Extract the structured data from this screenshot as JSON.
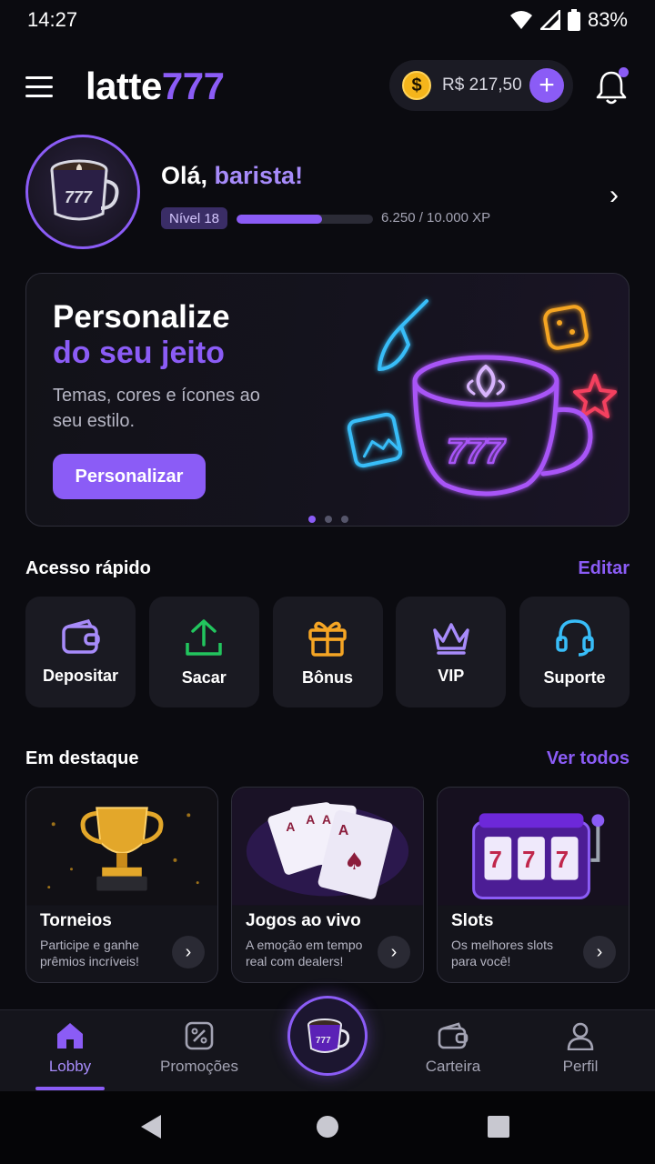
{
  "status": {
    "time": "14:27",
    "battery": "83%"
  },
  "header": {
    "logo_main": "latte",
    "logo_accent": "777",
    "balance": "R$ 217,50",
    "coin_symbol": "$",
    "add_symbol": "+"
  },
  "profile": {
    "greeting": "Olá, ",
    "name": "barista!",
    "level": "Nível 18",
    "xp_text": "6.250 / 10.000 XP",
    "xp_fraction": 0.625,
    "chevron": "›"
  },
  "banner": {
    "title_line1": "Personalize",
    "title_line2": "do seu jeito",
    "description": "Temas, cores e ícones ao seu estilo.",
    "button_label": "Personalizar",
    "page_count": 3,
    "active_page": 0
  },
  "quick_access": {
    "title": "Acesso rápido",
    "edit_label": "Editar",
    "items": [
      {
        "label": "Depositar",
        "icon": "wallet-icon",
        "color": "#a78bfa"
      },
      {
        "label": "Sacar",
        "icon": "upload-icon",
        "color": "#22c55e"
      },
      {
        "label": "Bônus",
        "icon": "gift-icon",
        "color": "#f5a524"
      },
      {
        "label": "VIP",
        "icon": "crown-icon",
        "color": "#a78bfa"
      },
      {
        "label": "Suporte",
        "icon": "headset-icon",
        "color": "#38bdf8"
      }
    ]
  },
  "featured": {
    "title": "Em destaque",
    "see_all_label": "Ver todos",
    "cards": [
      {
        "title": "Torneios",
        "description": "Participe e ganhe prêmios incríveis!",
        "icon": "trophy-icon"
      },
      {
        "title": "Jogos ao vivo",
        "description": "A emoção em tempo real com dealers!",
        "icon": "cards-icon"
      },
      {
        "title": "Slots",
        "description": "Os melhores slots para você!",
        "icon": "slot-machine-icon"
      }
    ],
    "arrow": "›"
  },
  "bottom_nav": {
    "items": [
      {
        "label": "Lobby",
        "icon": "home-icon"
      },
      {
        "label": "Promoções",
        "icon": "percent-icon"
      },
      {
        "label": "Carteira",
        "icon": "wallet-icon"
      },
      {
        "label": "Perfil",
        "icon": "user-icon"
      }
    ],
    "active": "Lobby",
    "accent": "#8b5cf6"
  },
  "theme": {
    "accent": "#8b5cf6",
    "background": "#0b0b10"
  }
}
